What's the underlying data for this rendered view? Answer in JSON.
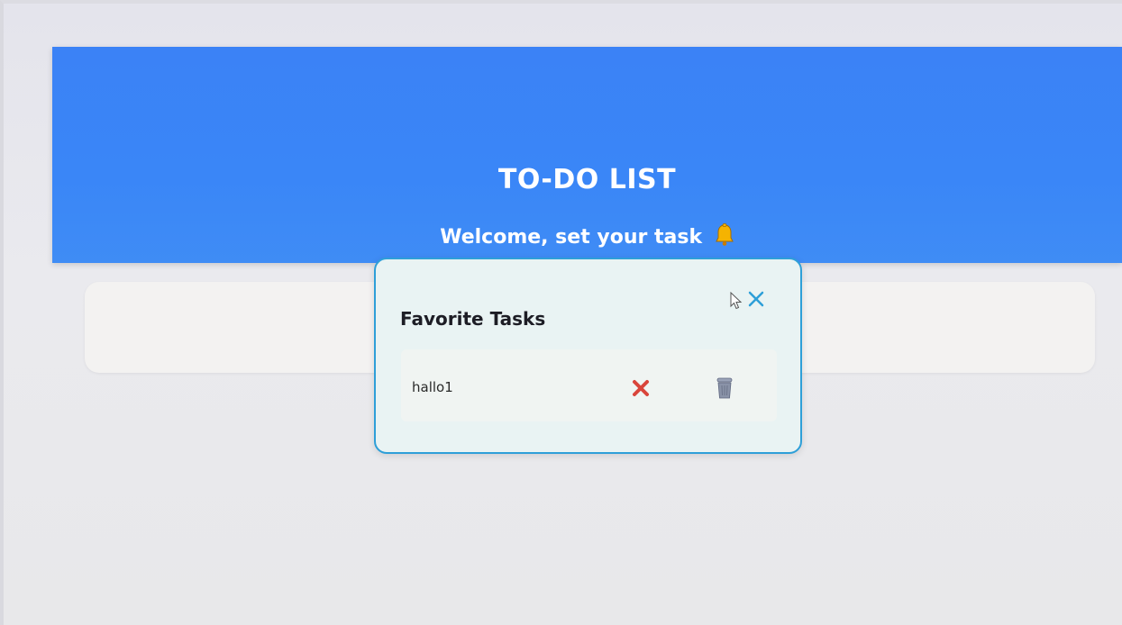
{
  "header": {
    "title": "TO-DO LIST",
    "subtitle": "Welcome, set your task"
  },
  "icons": {
    "bell": "bell-icon",
    "close": "close-icon",
    "unfavorite": "x-mark-icon",
    "delete": "trash-icon",
    "cursor": "mouse-pointer-icon"
  },
  "colors": {
    "header_bg": "#3b82f6",
    "modal_border": "#2e9fd8",
    "close_icon": "#2e9fd8",
    "x_mark": "#d9453b",
    "trash": "#8a93a8"
  },
  "favorites_modal": {
    "title": "Favorite Tasks",
    "tasks": [
      {
        "text": "hallo1"
      }
    ]
  }
}
